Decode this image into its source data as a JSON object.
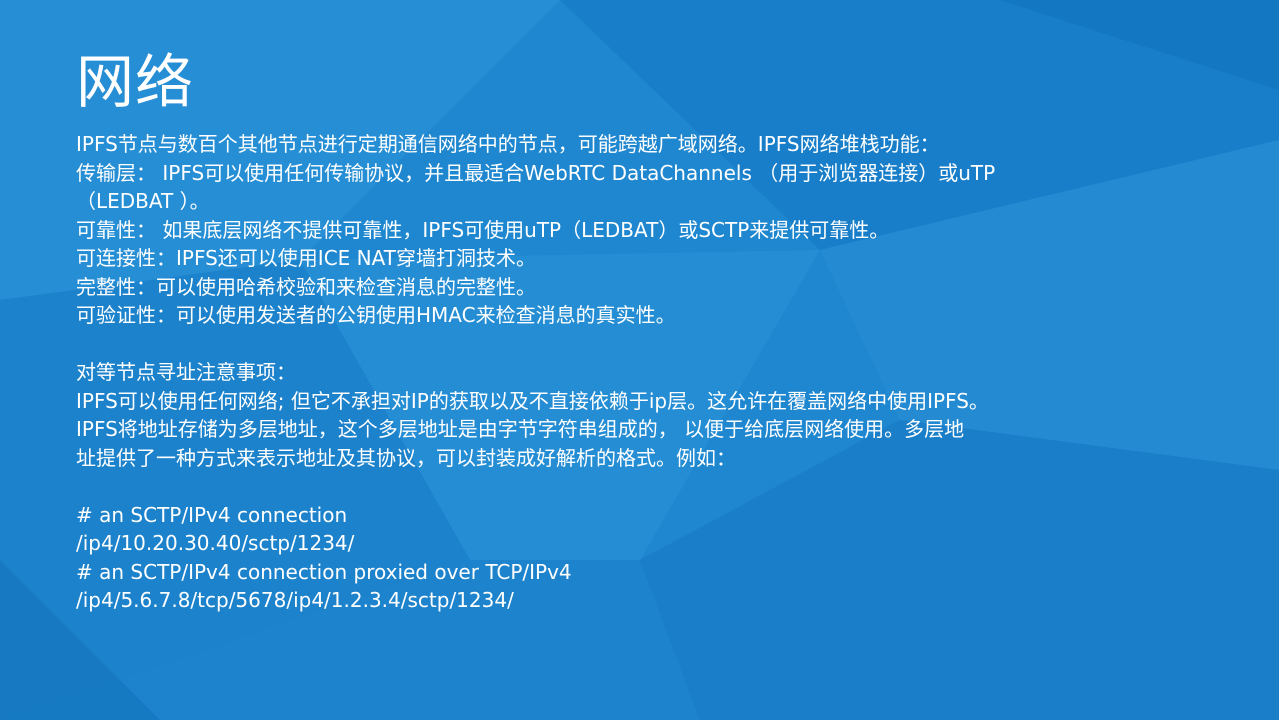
{
  "slide": {
    "title": "网络",
    "lines": [
      "IPFS节点与数百个其他节点进行定期通信网络中的节点，可能跨越广域网络。IPFS网络堆栈功能：",
      "传输层： IPFS可以使用任何传输协议，并且最适合WebRTC DataChannels （用于浏览器连接）或uTP",
      "（LEDBAT ）。",
      "可靠性： 如果底层网络不提供可靠性，IPFS可使用uTP（LEDBAT）或SCTP来提供可靠性。",
      "可连接性：IPFS还可以使用ICE NAT穿墙打洞技术。",
      "完整性：可以使用哈希校验和来检查消息的完整性。",
      "可验证性：可以使用发送者的公钥使用HMAC来检查消息的真实性。",
      "对等节点寻址注意事项：",
      "IPFS可以使用任何网络; 但它不承担对IP的获取以及不直接依赖于ip层。这允许在覆盖网络中使用IPFS。",
      "IPFS将地址存储为多层地址，这个多层地址是由字节字符串组成的， 以便于给底层网络使用。多层地",
      "址提供了一种方式来表示地址及其协议，可以封装成好解析的格式。例如：",
      "# an SCTP/IPv4 connection",
      "/ip4/10.20.30.40/sctp/1234/",
      "# an SCTP/IPv4 connection proxied over TCP/IPv4",
      "/ip4/5.6.7.8/tcp/5678/ip4/1.2.3.4/sctp/1234/"
    ]
  },
  "colors": {
    "background": "#1f86cf",
    "text": "#ffffff"
  }
}
